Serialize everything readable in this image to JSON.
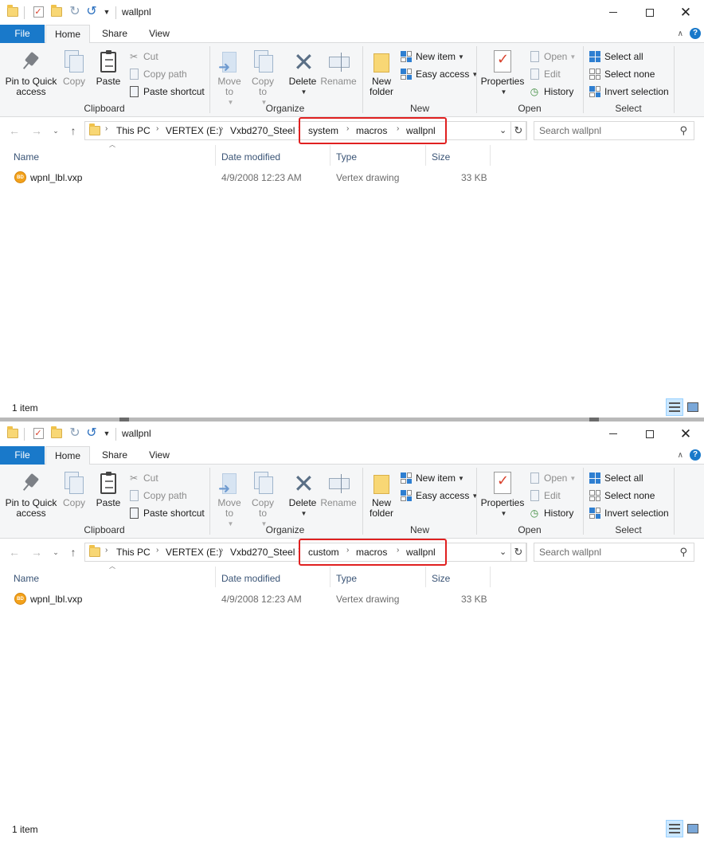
{
  "windows": [
    {
      "title": "wallpnl",
      "tabs": [
        "File",
        "Home",
        "Share",
        "View"
      ],
      "ribbon": {
        "clipboard": {
          "label": "Clipboard",
          "pin": "Pin to Quick access",
          "copy": "Copy",
          "paste": "Paste",
          "cut": "Cut",
          "copy_path": "Copy path",
          "paste_shortcut": "Paste shortcut"
        },
        "organize": {
          "label": "Organize",
          "move_to": "Move to",
          "copy_to": "Copy to",
          "delete": "Delete",
          "rename": "Rename"
        },
        "new": {
          "label": "New",
          "new_folder": "New folder",
          "new_item": "New item",
          "easy_access": "Easy access"
        },
        "open": {
          "label": "Open",
          "properties": "Properties",
          "open": "Open",
          "edit": "Edit",
          "history": "History"
        },
        "select": {
          "label": "Select",
          "select_all": "Select all",
          "select_none": "Select none",
          "invert": "Invert selection"
        }
      },
      "address": {
        "crumbs": [
          "This PC",
          "VERTEX (E:)",
          "Vxbd270_Steel",
          "system",
          "macros",
          "wallpnl"
        ]
      },
      "search_placeholder": "Search wallpnl",
      "columns": [
        "Name",
        "Date modified",
        "Type",
        "Size"
      ],
      "files": [
        {
          "name": "wpnl_lbl.vxp",
          "modified": "4/9/2008 12:23 AM",
          "type": "Vertex drawing",
          "size": "33 KB",
          "icon_text": "BD"
        }
      ],
      "status": "1 item"
    },
    {
      "title": "wallpnl",
      "tabs": [
        "File",
        "Home",
        "Share",
        "View"
      ],
      "ribbon": {
        "clipboard": {
          "label": "Clipboard",
          "pin": "Pin to Quick access",
          "copy": "Copy",
          "paste": "Paste",
          "cut": "Cut",
          "copy_path": "Copy path",
          "paste_shortcut": "Paste shortcut"
        },
        "organize": {
          "label": "Organize",
          "move_to": "Move to",
          "copy_to": "Copy to",
          "delete": "Delete",
          "rename": "Rename"
        },
        "new": {
          "label": "New",
          "new_folder": "New folder",
          "new_item": "New item",
          "easy_access": "Easy access"
        },
        "open": {
          "label": "Open",
          "properties": "Properties",
          "open": "Open",
          "edit": "Edit",
          "history": "History"
        },
        "select": {
          "label": "Select",
          "select_all": "Select all",
          "select_none": "Select none",
          "invert": "Invert selection"
        }
      },
      "address": {
        "crumbs": [
          "This PC",
          "VERTEX (E:)",
          "Vxbd270_Steel",
          "custom",
          "macros",
          "wallpnl"
        ]
      },
      "search_placeholder": "Search wallpnl",
      "columns": [
        "Name",
        "Date modified",
        "Type",
        "Size"
      ],
      "files": [
        {
          "name": "wpnl_lbl.vxp",
          "modified": "4/9/2008 12:23 AM",
          "type": "Vertex drawing",
          "size": "33 KB",
          "icon_text": "BD"
        }
      ],
      "status": "1 item"
    }
  ],
  "colors": {
    "file_tab": "#1979ca",
    "highlight": "#e02020",
    "ribbon_bg": "#f5f6f7"
  },
  "icons": [
    "folder-icon",
    "check-icon",
    "undo-icon",
    "redo-icon",
    "pin-icon",
    "copy-icon",
    "paste-icon",
    "cut-icon",
    "delete-icon",
    "rename-icon",
    "new-folder-icon",
    "properties-icon",
    "history-icon",
    "search-icon",
    "refresh-icon",
    "vertex-file-icon"
  ]
}
